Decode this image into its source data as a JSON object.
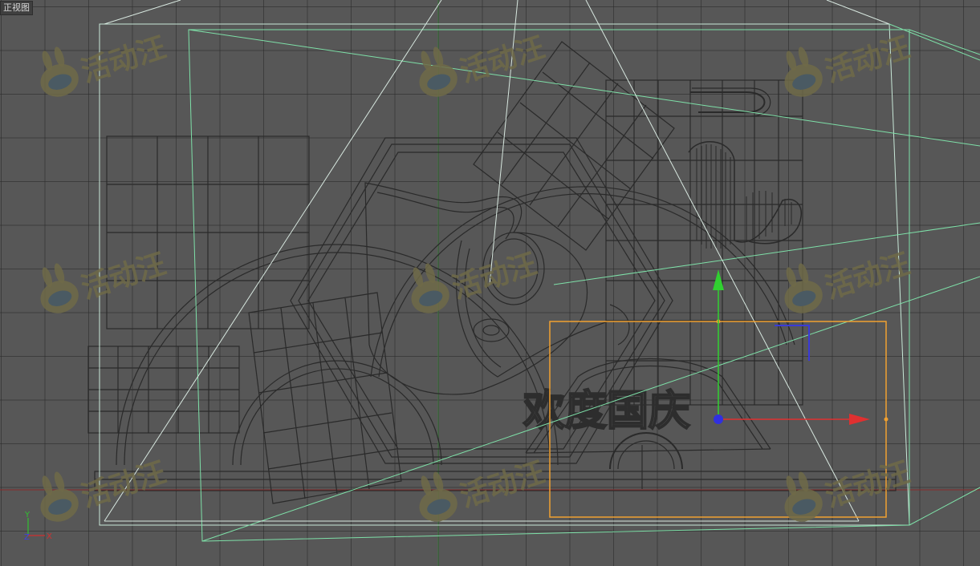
{
  "viewport": {
    "label": "正视图",
    "selection_color": "#f0a030",
    "camera_line_color": "#7ee0a8"
  },
  "model": {
    "banner_text": "欢度国庆"
  },
  "gizmo": {
    "x_axis_color": "#e03030",
    "y_axis_color": "#30d030",
    "origin_color": "#3030e0"
  },
  "axis_indicator": {
    "y_label": "Y",
    "x_label": "X",
    "z_label": "Z"
  },
  "watermark": {
    "text": "活动汪",
    "icon": "bunny-mascot-icon"
  }
}
